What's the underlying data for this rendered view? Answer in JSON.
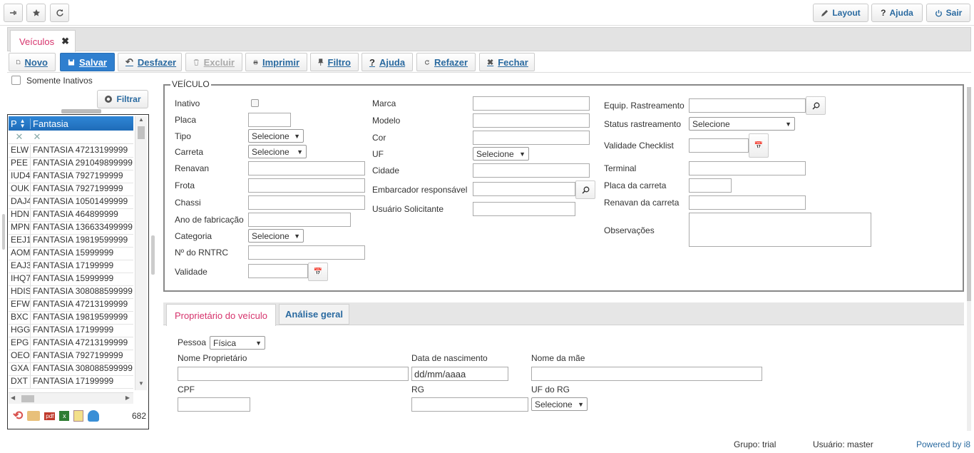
{
  "topbar": {
    "layout_label": "Layout",
    "help_label": "Ajuda",
    "exit_label": "Sair"
  },
  "tab": {
    "label": "Veículos"
  },
  "toolbar": {
    "novo": "Novo",
    "salvar": "Salvar",
    "desfazer": "Desfazer",
    "excluir": "Excluir",
    "imprimir": "Imprimir",
    "filtro": "Filtro",
    "ajuda": "Ajuda",
    "refazer": "Refazer",
    "fechar": "Fechar"
  },
  "sidebar": {
    "inactive_label": "Somente Inativos",
    "filter_label": "Filtrar",
    "col_p": "P",
    "col_fantasia": "Fantasia",
    "rows": [
      {
        "p": "ELW",
        "f": "FANTASIA 47213199999"
      },
      {
        "p": "PEE",
        "f": "FANTASIA 291049899999"
      },
      {
        "p": "IUD4",
        "f": "FANTASIA 7927199999"
      },
      {
        "p": "OUK",
        "f": "FANTASIA 7927199999"
      },
      {
        "p": "DAJ4",
        "f": "FANTASIA 10501499999"
      },
      {
        "p": "HDN",
        "f": "FANTASIA 464899999"
      },
      {
        "p": "MPN",
        "f": "FANTASIA 136633499999"
      },
      {
        "p": "EEJ1",
        "f": "FANTASIA 19819599999"
      },
      {
        "p": "AOM",
        "f": "FANTASIA 15999999"
      },
      {
        "p": "EAJ3",
        "f": "FANTASIA 17199999"
      },
      {
        "p": "IHQ7",
        "f": "FANTASIA 15999999"
      },
      {
        "p": "HDIS",
        "f": "FANTASIA 308088599999"
      },
      {
        "p": "EFW",
        "f": "FANTASIA 47213199999"
      },
      {
        "p": "BXC",
        "f": "FANTASIA 19819599999"
      },
      {
        "p": "HGG",
        "f": "FANTASIA 17199999"
      },
      {
        "p": "EPG",
        "f": "FANTASIA 47213199999"
      },
      {
        "p": "OEO",
        "f": "FANTASIA 7927199999"
      },
      {
        "p": "GXA",
        "f": "FANTASIA 308088599999"
      },
      {
        "p": "DXT",
        "f": "FANTASIA 17199999"
      }
    ],
    "count": "682"
  },
  "veiculo": {
    "legend": "VEÍCULO",
    "inativo": "Inativo",
    "placa": "Placa",
    "tipo": "Tipo",
    "carreta": "Carreta",
    "renavan": "Renavan",
    "frota": "Frota",
    "chassi": "Chassi",
    "ano": "Ano de fabricação",
    "categoria": "Categoria",
    "rntrc": "Nº do RNTRC",
    "validade": "Validade",
    "marca": "Marca",
    "modelo": "Modelo",
    "cor": "Cor",
    "uf": "UF",
    "cidade": "Cidade",
    "embarcador": "Embarcador responsável",
    "usuario": "Usuário Solicitante",
    "equip": "Equip. Rastreamento",
    "status": "Status rastreamento",
    "checklist": "Validade Checklist",
    "terminal": "Terminal",
    "placa_carreta": "Placa da carreta",
    "renavan_carreta": "Renavan da carreta",
    "obs": "Observações",
    "select_default": "Selecione"
  },
  "subtabs": {
    "proprietario": "Proprietário do veículo",
    "analise": "Análise geral"
  },
  "proprietario": {
    "pessoa": "Pessoa",
    "pessoa_value": "Física",
    "nome": "Nome Proprietário",
    "nascimento": "Data de nascimento",
    "nascimento_value": "dd/mm/aaaa",
    "mae": "Nome da mãe",
    "cpf": "CPF",
    "rg": "RG",
    "uf_rg": "UF do RG",
    "uf_rg_value": "Selecione"
  },
  "footer": {
    "grupo": "Grupo: trial",
    "usuario": "Usuário: master",
    "powered": "Powered by i8"
  },
  "colors": {
    "accent": "#2f7fcf",
    "tab_active": "#d6336c",
    "link": "#2a6aa0"
  }
}
